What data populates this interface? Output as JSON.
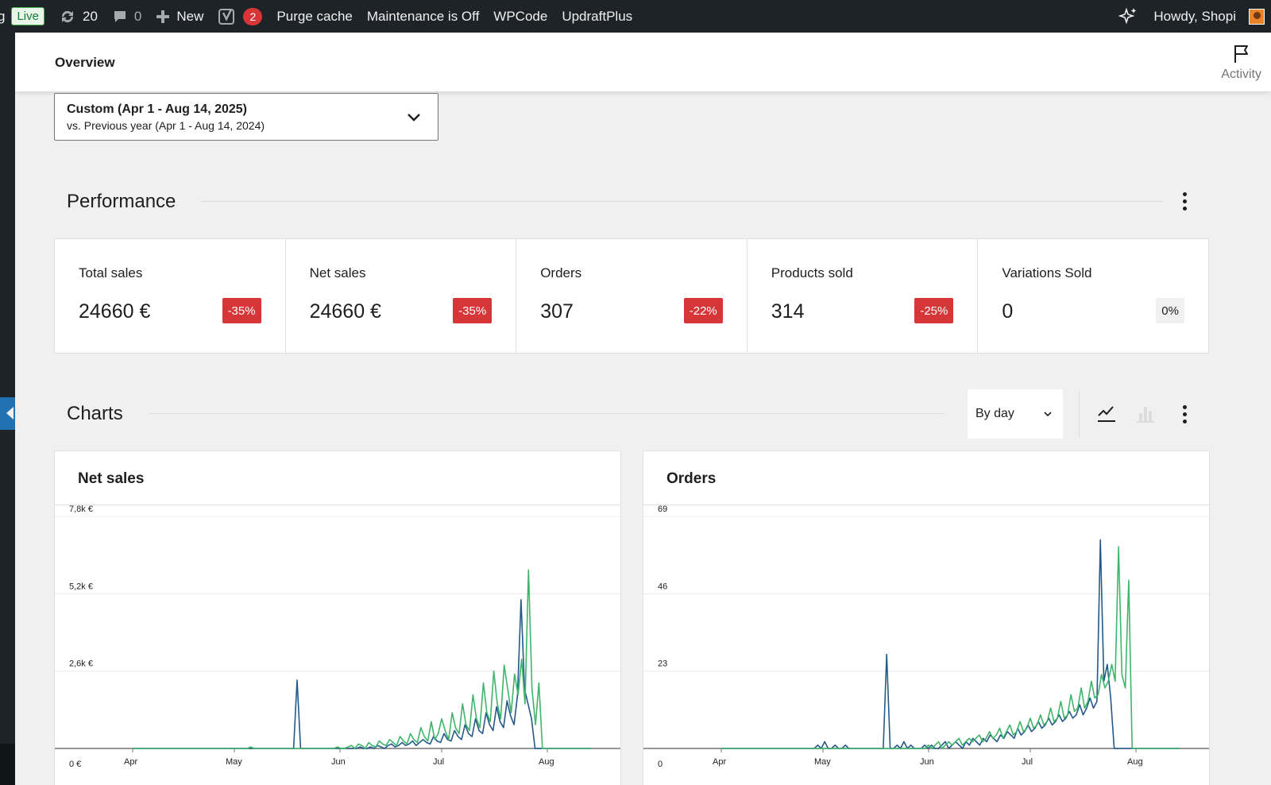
{
  "adminbar": {
    "site_fragment": "g",
    "live_label": "Live",
    "updates_count": "20",
    "comments_count": "0",
    "new_label": "New",
    "yoast_count": "2",
    "purge_cache": "Purge cache",
    "maintenance": "Maintenance is Off",
    "wpcode": "WPCode",
    "updraftplus": "UpdraftPlus",
    "howdy": "Howdy, Shopi"
  },
  "header": {
    "title": "Overview",
    "activity_label": "Activity"
  },
  "date_range": {
    "primary": "Custom (Apr 1 - Aug 14, 2025)",
    "secondary": "vs. Previous year (Apr 1 - Aug 14, 2024)"
  },
  "performance": {
    "title": "Performance",
    "cards": [
      {
        "label": "Total sales",
        "value": "24660 €",
        "delta": "-35%",
        "trend": "negative"
      },
      {
        "label": "Net sales",
        "value": "24660 €",
        "delta": "-35%",
        "trend": "negative"
      },
      {
        "label": "Orders",
        "value": "307",
        "delta": "-22%",
        "trend": "negative"
      },
      {
        "label": "Products sold",
        "value": "314",
        "delta": "-25%",
        "trend": "negative"
      },
      {
        "label": "Variations Sold",
        "value": "0",
        "delta": "0%",
        "trend": "neutral"
      }
    ]
  },
  "charts_section": {
    "title": "Charts",
    "interval": "By day"
  },
  "colors": {
    "current": "#3fb56b",
    "previous": "#24598a",
    "negative_badge": "#d63638"
  },
  "chart_data": [
    {
      "type": "line",
      "title": "Net sales",
      "yticks": [
        "0 €",
        "2,6k €",
        "5,2k €",
        "7,8k €"
      ],
      "ylim": [
        0,
        7800
      ],
      "xticks": [
        "Apr",
        "May",
        "Jun",
        "Jul",
        "Aug"
      ],
      "x_range": [
        "Apr 1",
        "Aug 14"
      ],
      "series": [
        {
          "role": "current",
          "values": [
            0,
            0,
            0,
            0,
            0,
            0,
            0,
            0,
            0,
            0,
            0,
            0,
            0,
            0,
            0,
            0,
            0,
            0,
            0,
            0,
            0,
            0,
            0,
            0,
            0,
            0,
            0,
            0,
            0,
            0,
            0,
            0,
            0,
            0,
            50,
            0,
            0,
            0,
            0,
            0,
            0,
            0,
            0,
            0,
            0,
            0,
            0,
            0,
            0,
            0,
            0,
            0,
            0,
            0,
            0,
            0,
            0,
            0,
            0,
            50,
            0,
            0,
            50,
            100,
            0,
            150,
            100,
            0,
            200,
            100,
            50,
            250,
            150,
            100,
            300,
            200,
            100,
            400,
            250,
            150,
            500,
            300,
            200,
            700,
            400,
            250,
            900,
            300,
            500,
            1000,
            600,
            300,
            1200,
            700,
            500,
            1500,
            800,
            600,
            1800,
            1000,
            700,
            2200,
            1200,
            900,
            2600,
            1500,
            1000,
            2800,
            2000,
            1200,
            2500,
            1800,
            3000,
            1500,
            6000,
            2000,
            800,
            2200,
            0,
            0,
            0,
            0,
            0,
            0,
            0,
            0,
            0,
            0,
            0,
            0,
            0,
            0,
            0
          ]
        },
        {
          "role": "previous",
          "values": [
            0,
            0,
            0,
            0,
            0,
            0,
            0,
            0,
            0,
            0,
            0,
            0,
            0,
            0,
            0,
            0,
            0,
            0,
            0,
            0,
            0,
            0,
            0,
            0,
            0,
            0,
            0,
            0,
            0,
            0,
            0,
            0,
            0,
            0,
            0,
            0,
            0,
            0,
            0,
            0,
            0,
            0,
            0,
            0,
            0,
            0,
            0,
            2300,
            0,
            0,
            0,
            0,
            0,
            0,
            0,
            0,
            0,
            0,
            0,
            0,
            0,
            0,
            0,
            0,
            0,
            50,
            0,
            0,
            50,
            0,
            100,
            50,
            0,
            100,
            150,
            50,
            100,
            200,
            100,
            150,
            250,
            100,
            200,
            300,
            200,
            150,
            400,
            250,
            200,
            500,
            300,
            250,
            600,
            400,
            300,
            800,
            500,
            400,
            1000,
            600,
            500,
            1200,
            800,
            600,
            1400,
            900,
            700,
            1600,
            1100,
            800,
            1800,
            5000,
            2000,
            1500,
            1000,
            0,
            0,
            0,
            0,
            0,
            0,
            0,
            0,
            0,
            0,
            0,
            0,
            0,
            0,
            0,
            0,
            0
          ]
        }
      ]
    },
    {
      "type": "line",
      "title": "Orders",
      "yticks": [
        "0",
        "23",
        "46",
        "69"
      ],
      "ylim": [
        0,
        69
      ],
      "xticks": [
        "Apr",
        "May",
        "Jun",
        "Jul",
        "Aug"
      ],
      "x_range": [
        "Apr 1",
        "Aug 14"
      ],
      "series": [
        {
          "role": "current",
          "values": [
            0,
            0,
            0,
            0,
            0,
            0,
            0,
            0,
            0,
            0,
            0,
            0,
            0,
            0,
            0,
            0,
            0,
            0,
            0,
            0,
            0,
            0,
            0,
            0,
            0,
            0,
            0,
            0,
            0,
            0,
            0,
            0,
            0,
            0,
            0,
            0,
            0,
            0,
            0,
            0,
            0,
            0,
            0,
            0,
            0,
            0,
            0,
            0,
            0,
            0,
            0,
            0,
            0,
            0,
            0,
            0,
            0,
            0,
            0,
            0,
            0,
            1,
            0,
            1,
            2,
            0,
            1,
            2,
            1,
            2,
            3,
            1,
            2,
            3,
            2,
            3,
            4,
            2,
            3,
            5,
            3,
            4,
            6,
            3,
            5,
            7,
            4,
            5,
            8,
            5,
            6,
            9,
            6,
            7,
            10,
            7,
            8,
            12,
            8,
            9,
            14,
            9,
            10,
            16,
            11,
            12,
            18,
            12,
            14,
            20,
            15,
            16,
            22,
            18,
            20,
            25,
            20,
            60,
            22,
            18,
            50,
            0,
            0,
            0,
            0,
            0,
            0,
            0,
            0,
            0,
            0,
            0,
            0,
            0,
            0,
            0
          ]
        },
        {
          "role": "previous",
          "values": [
            0,
            0,
            0,
            0,
            0,
            0,
            0,
            0,
            0,
            0,
            0,
            0,
            0,
            0,
            0,
            0,
            0,
            0,
            0,
            0,
            0,
            0,
            0,
            0,
            0,
            0,
            0,
            0,
            1,
            0,
            2,
            0,
            0,
            1,
            0,
            0,
            1,
            0,
            0,
            0,
            0,
            0,
            0,
            0,
            0,
            0,
            0,
            0,
            28,
            0,
            0,
            1,
            0,
            2,
            0,
            1,
            0,
            0,
            0,
            1,
            0,
            1,
            0,
            0,
            1,
            2,
            0,
            1,
            2,
            1,
            0,
            2,
            1,
            3,
            2,
            1,
            3,
            2,
            4,
            3,
            2,
            4,
            3,
            5,
            4,
            3,
            6,
            4,
            5,
            7,
            5,
            6,
            8,
            6,
            7,
            9,
            7,
            8,
            10,
            8,
            9,
            11,
            9,
            10,
            13,
            10,
            12,
            15,
            12,
            14,
            62,
            20,
            25,
            15,
            0,
            0,
            0,
            0,
            0,
            0,
            0,
            0,
            0,
            0,
            0,
            0,
            0,
            0,
            0,
            0,
            0,
            0,
            0,
            0
          ]
        }
      ]
    }
  ]
}
